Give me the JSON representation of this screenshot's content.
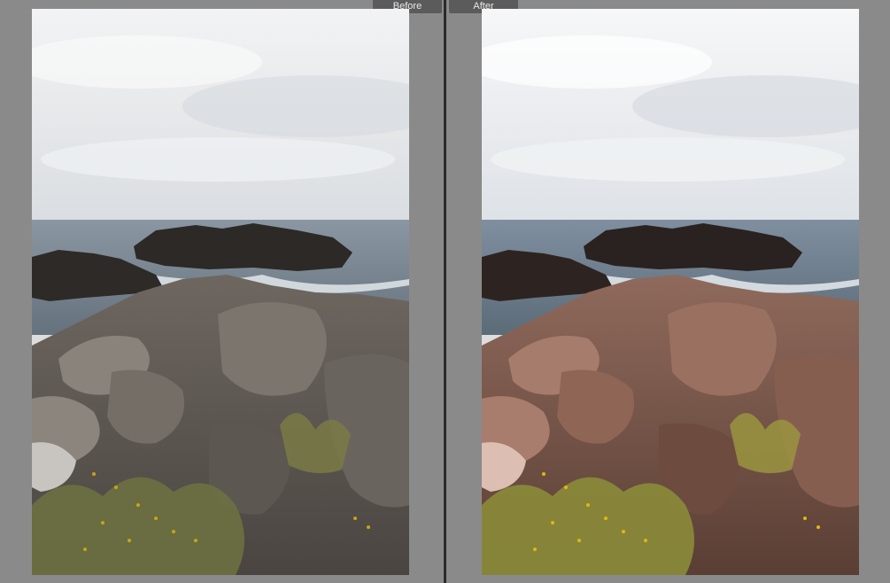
{
  "view": {
    "before_label": "Before",
    "after_label": "After"
  },
  "colors": {
    "workspace_bg": "#8a8a8a",
    "divider": "#2a2a2a",
    "label_bg": "#5b5b5b",
    "label_text": "#e8e8e8"
  },
  "icons": {
    "before_photo": "coastal-rocks-photo",
    "after_photo": "coastal-rocks-photo-edited"
  }
}
